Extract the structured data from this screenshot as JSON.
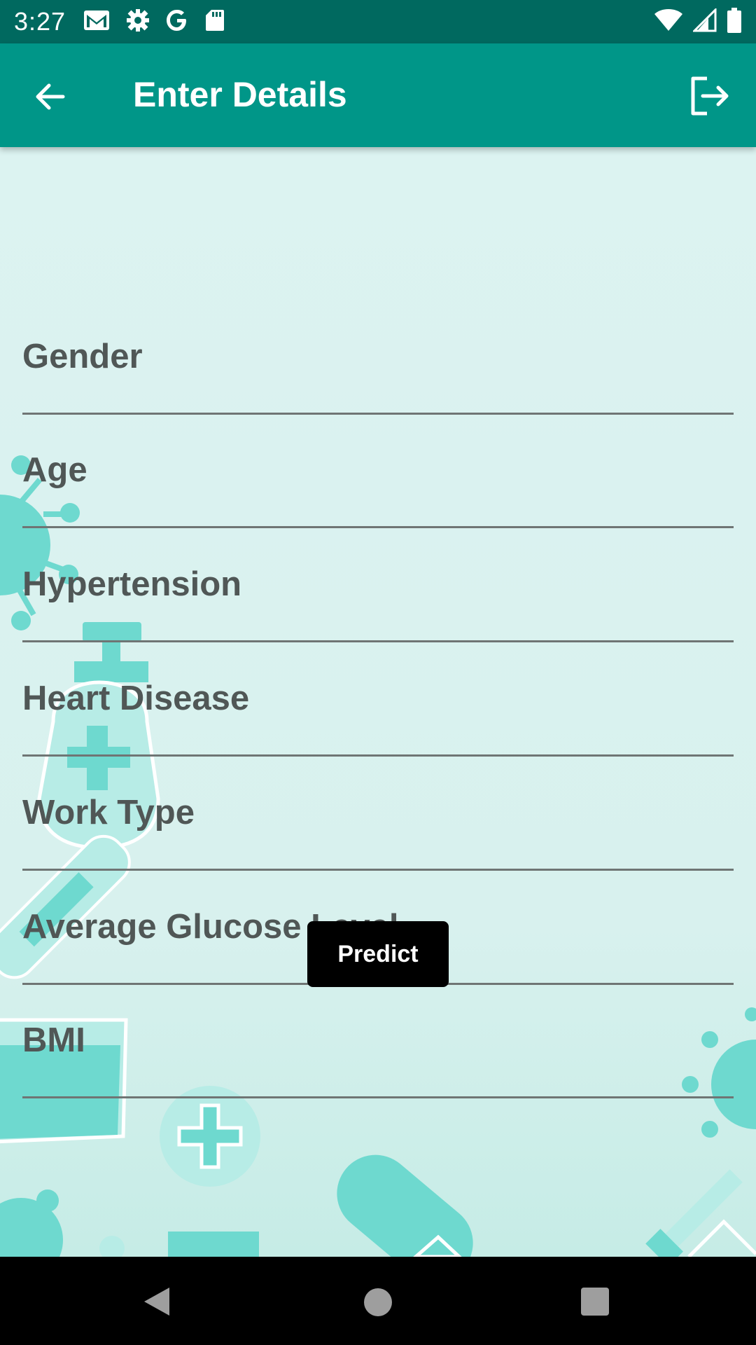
{
  "status_bar": {
    "time": "3:27",
    "left_icons": [
      "gmail-icon",
      "settings-icon",
      "google-icon",
      "sd-card-icon"
    ],
    "right_icons": [
      "wifi-icon",
      "signal-icon",
      "battery-icon"
    ]
  },
  "app_bar": {
    "title": "Enter Details",
    "back_icon": "arrow-left-icon",
    "logout_icon": "logout-icon",
    "color": "#009688"
  },
  "form": {
    "fields": [
      {
        "label": "Gender"
      },
      {
        "label": "Age"
      },
      {
        "label": "Hypertension"
      },
      {
        "label": "Heart Disease"
      },
      {
        "label": "Work Type"
      },
      {
        "label": "Average Glucose Level"
      },
      {
        "label": "BMI"
      }
    ]
  },
  "predict_button": {
    "label": "Predict"
  },
  "nav_bar": {
    "icons": [
      "nav-back-icon",
      "nav-home-icon",
      "nav-recents-icon"
    ]
  }
}
